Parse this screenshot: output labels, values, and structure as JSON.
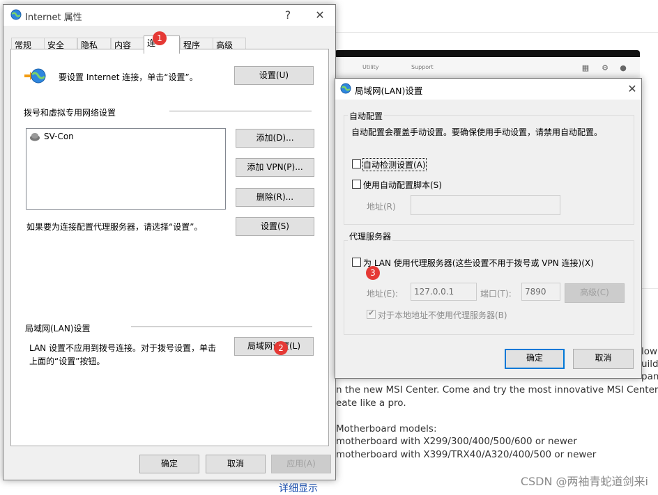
{
  "background": {
    "app_nav": [
      "Utility",
      "Support"
    ],
    "text_lines": [
      "low",
      "uild",
      "pan",
      "n the new MSI Center. Come and try the most innovative MSI Center which",
      "eate like a pro.",
      "Motherboard models:",
      "motherboard with X299/300/400/500/600 or newer",
      "motherboard with X399/TRX40/A320/400/500 or newer"
    ],
    "detail_link": "详细显示",
    "watermark": "CSDN @两袖青蛇道剑来i"
  },
  "internet_props": {
    "title": "Internet 属性",
    "help": "?",
    "close": "✕",
    "tabs": [
      "常规",
      "安全",
      "隐私",
      "内容",
      "连",
      "程序",
      "高级"
    ],
    "setup_text": "要设置 Internet 连接，单击“设置”。",
    "setup_button": "设置(U)",
    "dialup_section": "拨号和虚拟专用网络设置",
    "connection_item": "SV-Con",
    "add_button": "添加(D)...",
    "add_vpn_button": "添加 VPN(P)...",
    "delete_button": "删除(R)...",
    "proxy_hint": "如果要为连接配置代理服务器，请选择“设置”。",
    "settings_button": "设置(S)",
    "lan_section": "局域网(LAN)设置",
    "lan_text_1": "LAN 设置不应用到拨号连接。对于拨号设置，单击",
    "lan_text_2": "上面的“设置”按钮。",
    "lan_button": "局域网设置(L)",
    "ok": "确定",
    "cancel": "取消",
    "apply": "应用(A)"
  },
  "lan_dialog": {
    "title": "局域网(LAN)设置",
    "close": "✕",
    "auto_config_group": "自动配置",
    "auto_config_text": "自动配置会覆盖手动设置。要确保使用手动设置，请禁用自动配置。",
    "auto_detect_label": "自动检测设置(A)",
    "auto_detect_checked": false,
    "auto_script_label": "使用自动配置脚本(S)",
    "auto_script_checked": false,
    "address_label": "地址(R)",
    "address_value": "",
    "proxy_group": "代理服务器",
    "use_proxy_label": "为 LAN 使用代理服务器(这些设置不用于拨号或 VPN 连接)(X)",
    "use_proxy_checked": false,
    "proxy_address_label": "地址(E):",
    "proxy_address_value": "127.0.0.1",
    "port_label": "端口(T):",
    "port_value": "7890",
    "advanced_button": "高级(C)",
    "bypass_label": "对于本地地址不使用代理服务器(B)",
    "bypass_checked": true,
    "ok": "确定",
    "cancel": "取消"
  },
  "annotations": [
    "1",
    "2",
    "3"
  ]
}
